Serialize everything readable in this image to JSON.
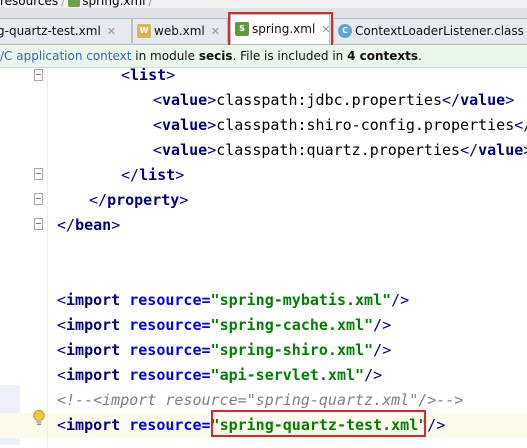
{
  "breadcrumb": {
    "folder": "resources",
    "file": "spring.xml"
  },
  "tabs": [
    {
      "label": "g-quartz-test.xml",
      "icon": "spring-xml-icon"
    },
    {
      "label": "web.xml",
      "icon": "web-xml-icon"
    },
    {
      "label": "spring.xml",
      "icon": "spring-xml-icon",
      "active": true
    },
    {
      "label": "ContextLoaderListener.class",
      "icon": "class-file-icon"
    }
  ],
  "infobar": {
    "link": "/C application context",
    "in_module": " in module ",
    "module": "secis",
    "middle": ". File is included in ",
    "count": "4",
    "contexts": " contexts",
    "end": "."
  },
  "code": {
    "list_open": "list",
    "value_tag": "value",
    "values": [
      "classpath:jdbc.properties",
      "classpath:shiro-config.properties",
      "classpath:quartz.properties"
    ],
    "list_close": "list",
    "property_close": "property",
    "bean_close": "bean",
    "import_tag": "import",
    "resource_attr": "resource",
    "imports": [
      "spring-mybatis.xml",
      "spring-cache.xml",
      "spring-shiro.xml",
      "api-servlet.xml"
    ],
    "comment": "<!--<import resource=\"spring-quartz.xml\"/>-->",
    "last_import": "spring-quartz-test.xml"
  },
  "colors": {
    "highlight_border": "#d62b2b",
    "tag": "#000080",
    "attr": "#0000ff",
    "value": "#008000",
    "comment": "#808080"
  }
}
